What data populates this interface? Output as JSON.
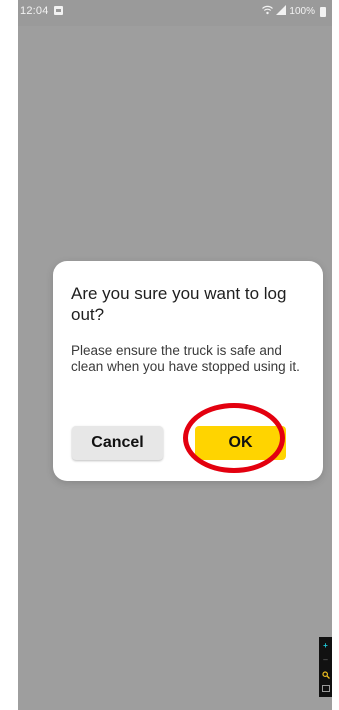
{
  "status_bar": {
    "time": "12:04",
    "battery_percent": "100%",
    "icons": [
      "notification-icon",
      "wifi-icon",
      "signal-icon",
      "battery-icon"
    ]
  },
  "dialog": {
    "title": "Are you sure you want to log out?",
    "message": "Please ensure the truck is safe and clean when you have stopped using it.",
    "cancel_label": "Cancel",
    "ok_label": "OK"
  },
  "colors": {
    "overlay": "#9e9e9e",
    "ok_button": "#ffd400",
    "cancel_button": "#e7e7e7",
    "highlight": "#e3000f"
  },
  "side_toolbar": {
    "icons": [
      "zoom-in-icon",
      "zoom-out-icon",
      "search-icon",
      "frame-icon"
    ]
  }
}
